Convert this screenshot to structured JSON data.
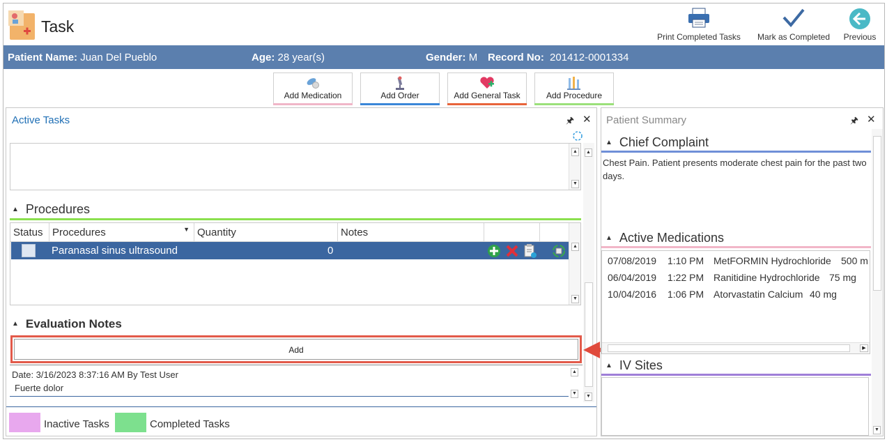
{
  "app": {
    "title": "Task"
  },
  "toolbar": {
    "print_label": "Print Completed Tasks",
    "mark_label": "Mark as Completed",
    "previous_label": "Previous"
  },
  "patient": {
    "name_label": "Patient Name:",
    "name": "Juan Del Pueblo",
    "age_label": "Age:",
    "age": "28 year(s)",
    "gender_label": "Gender:",
    "gender": "M",
    "record_label": "Record No:",
    "record": "201412-0001334"
  },
  "actions": {
    "add_medication": "Add Medication",
    "add_order": "Add Order",
    "add_general_task": "Add General Task",
    "add_procedure": "Add Procedure"
  },
  "active_tasks": {
    "title": "Active Tasks",
    "procedures": {
      "heading": "Procedures",
      "columns": [
        "Status",
        "Procedures",
        "Quantity",
        "Notes"
      ],
      "rows": [
        {
          "procedure": "Paranasal sinus ultrasound",
          "quantity": "0"
        }
      ]
    },
    "evaluation": {
      "heading": "Evaluation Notes",
      "add_label": "Add",
      "note_meta": "Date: 3/16/2023 8:37:16 AM By Test User",
      "note_text": "Fuerte dolor"
    },
    "legend": {
      "inactive": "Inactive Tasks",
      "completed": "Completed Tasks"
    }
  },
  "summary": {
    "title": "Patient Summary",
    "chief": {
      "heading": "Chief Complaint",
      "text": "Chest Pain. Patient presents moderate chest pain for the past two days."
    },
    "medications": {
      "heading": "Active Medications",
      "rows": [
        {
          "date": "07/08/2019",
          "time": "1:10 PM",
          "name": "MetFORMIN Hydrochloride",
          "dose": "500 m"
        },
        {
          "date": "06/04/2019",
          "time": "1:22 PM",
          "name": "Ranitidine Hydrochloride",
          "dose": "75 mg"
        },
        {
          "date": "10/04/2016",
          "time": "1:06 PM",
          "name": "Atorvastatin Calcium",
          "dose": "40 mg"
        }
      ]
    },
    "iv": {
      "heading": "IV Sites"
    }
  },
  "colors": {
    "patient_bar": "#5b7fae",
    "selected_row": "#3b66a0",
    "highlight": "#e25a4a",
    "inactive": "#e8a8ee",
    "completed": "#7de08e"
  }
}
